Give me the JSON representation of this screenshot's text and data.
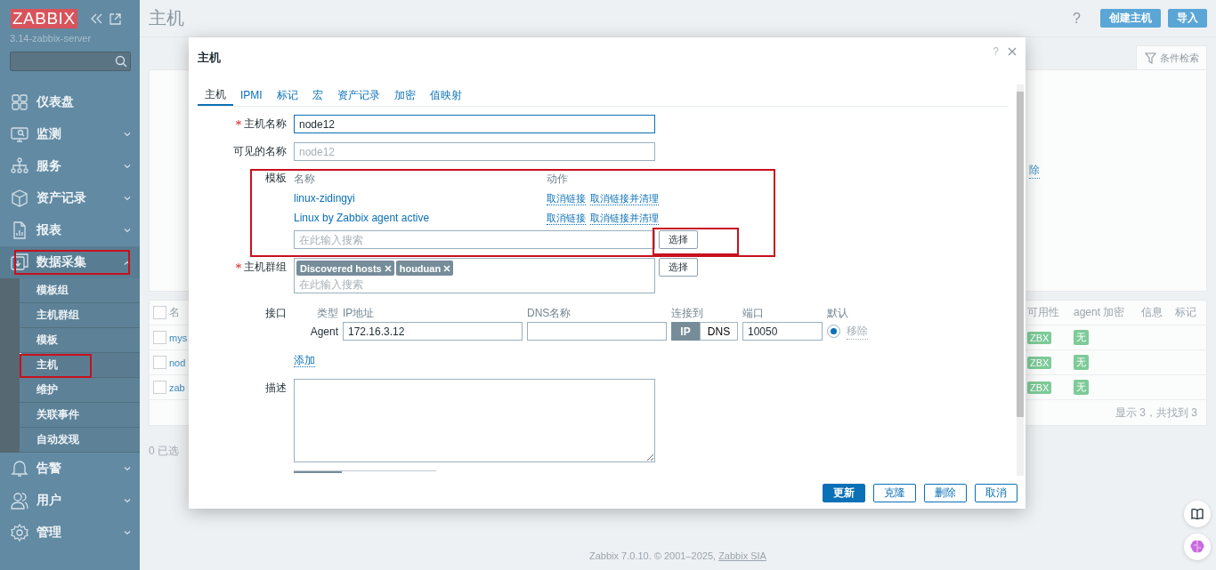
{
  "sidebar": {
    "logo": "ZABBIX",
    "server": "3.14-zabbix-server",
    "menu": [
      {
        "label": "仪表盘",
        "expanded": false
      },
      {
        "label": "监测",
        "expanded": false,
        "has_children": true
      },
      {
        "label": "服务",
        "expanded": false,
        "has_children": true
      },
      {
        "label": "资产记录",
        "expanded": false,
        "has_children": true
      },
      {
        "label": "报表",
        "expanded": false,
        "has_children": true
      },
      {
        "label": "数据采集",
        "expanded": true,
        "has_children": true,
        "children": [
          {
            "label": "模板组",
            "selected": false
          },
          {
            "label": "主机群组",
            "selected": false
          },
          {
            "label": "模板",
            "selected": false
          },
          {
            "label": "主机",
            "selected": true
          },
          {
            "label": "维护",
            "selected": false
          },
          {
            "label": "关联事件",
            "selected": false
          },
          {
            "label": "自动发现",
            "selected": false
          }
        ]
      },
      {
        "label": "告警",
        "expanded": false,
        "has_children": true
      },
      {
        "label": "用户",
        "expanded": false,
        "has_children": true
      },
      {
        "label": "管理",
        "expanded": false,
        "has_children": true
      }
    ]
  },
  "page": {
    "title": "主机",
    "help": "?",
    "buttons": [
      "创建主机",
      "导入"
    ],
    "filter_tab": "条件检索",
    "filter_fragment": "除",
    "table": {
      "select_all_checked": false,
      "columns": [
        "名",
        "可用性",
        "agent 加密",
        "信息",
        "标记"
      ],
      "rows": [
        {
          "name": "mys",
          "availability": "ZBX",
          "encryption": "无",
          "checked": false
        },
        {
          "name": "nod",
          "availability": "ZBX",
          "encryption": "无",
          "checked": false
        },
        {
          "name": "zab",
          "availability": "ZBX",
          "encryption": "无",
          "checked": false
        }
      ],
      "summary": "显示 3，共找到 3"
    },
    "selected_count": "0 已选",
    "footer": {
      "text": "Zabbix 7.0.10. © 2001–2025, ",
      "link": "Zabbix SIA"
    }
  },
  "dialog": {
    "title": "主机",
    "help": "?",
    "tabs": [
      {
        "label": "主机",
        "selected": true
      },
      {
        "label": "IPMI",
        "selected": false
      },
      {
        "label": "标记",
        "selected": false
      },
      {
        "label": "宏",
        "selected": false
      },
      {
        "label": "资产记录",
        "selected": false
      },
      {
        "label": "加密",
        "selected": false
      },
      {
        "label": "值映射",
        "selected": false
      }
    ],
    "host_name": {
      "label": "主机名称",
      "required": true,
      "value": "node12"
    },
    "visible_name": {
      "label": "可见的名称",
      "required": false,
      "placeholder": "node12"
    },
    "templates": {
      "label": "模板",
      "columns": [
        "名称",
        "动作"
      ],
      "rows": [
        {
          "name": "linux-zidingyi",
          "actions": [
            "取消链接",
            "取消链接并清理"
          ]
        },
        {
          "name": "Linux by Zabbix agent active",
          "actions": [
            "取消链接",
            "取消链接并清理"
          ]
        }
      ],
      "placeholder": "在此输入搜索",
      "button": "选择"
    },
    "host_groups": {
      "label": "主机群组",
      "required": true,
      "tags": [
        "Discovered hosts",
        "houduan"
      ],
      "placeholder": "在此输入搜索",
      "button": "选择"
    },
    "interfaces": {
      "label": "接口",
      "columns": [
        "类型",
        "IP地址",
        "DNS名称",
        "连接到",
        "端口",
        "默认"
      ],
      "rows": [
        {
          "type": "Agent",
          "ip": "172.16.3.12",
          "connect": [
            {
              "label": "IP",
              "selected": true
            },
            {
              "label": "DNS",
              "selected": false
            }
          ],
          "port": "10050",
          "default": true,
          "remove": "移除"
        }
      ],
      "add": "添加"
    },
    "description": {
      "label": "描述"
    },
    "buttons": [
      {
        "label": "更新",
        "kind": "primary"
      },
      {
        "label": "克隆",
        "kind": "secondary"
      },
      {
        "label": "删除",
        "kind": "secondary"
      },
      {
        "label": "取消",
        "kind": "secondary"
      }
    ]
  }
}
